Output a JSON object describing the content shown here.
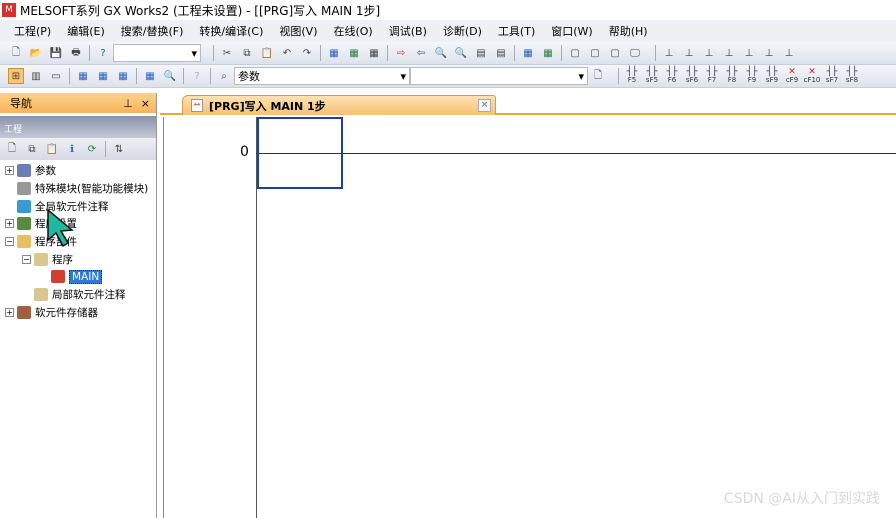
{
  "window": {
    "app_icon": "MELSOFT",
    "title": "MELSOFT系列 GX Works2 (工程未设置) - [[PRG]写入 MAIN 1步]"
  },
  "menu": [
    "工程(P)",
    "编辑(E)",
    "搜索/替换(F)",
    "转换/编译(C)",
    "视图(V)",
    "在线(O)",
    "调试(B)",
    "诊断(D)",
    "工具(T)",
    "窗口(W)",
    "帮助(H)"
  ],
  "toolbar": {
    "search_combo": "",
    "param_combo": "参数",
    "combo3": "",
    "fkeys": [
      "F5",
      "sF5",
      "F6",
      "sF6",
      "F7",
      "F8",
      "F9",
      "sF9",
      "cF9",
      "cF10",
      "sF7",
      "sF8"
    ]
  },
  "nav": {
    "title": "导航",
    "pin": "ᵖ",
    "close": "×",
    "project_label": "工程",
    "tree": [
      {
        "label": "参数",
        "exp": "+",
        "level": 0,
        "color": "#6a7fb8"
      },
      {
        "label": "特殊模块(智能功能模块)",
        "exp": "",
        "level": 0,
        "color": "#999"
      },
      {
        "label": "全局软元件注释",
        "exp": "",
        "level": 0,
        "color": "#3a9ad0"
      },
      {
        "label": "程序设置",
        "exp": "+",
        "level": 0,
        "color": "#5a8a40"
      },
      {
        "label": "程序部件",
        "exp": "−",
        "level": 0,
        "color": "#e8c060"
      },
      {
        "label": "程序",
        "exp": "−",
        "level": 1,
        "color": "#d8c890"
      },
      {
        "label": "MAIN",
        "exp": "",
        "level": 2,
        "color": "#d04030",
        "selected": true
      },
      {
        "label": "局部软元件注释",
        "exp": "",
        "level": 1,
        "color": "#d8c890"
      },
      {
        "label": "软元件存储器",
        "exp": "+",
        "level": 0,
        "color": "#a06040"
      }
    ]
  },
  "tab": {
    "label": "[PRG]写入 MAIN 1步",
    "close": "×"
  },
  "editor": {
    "step": "0"
  },
  "watermark": "CSDN @AI从入门到实践"
}
